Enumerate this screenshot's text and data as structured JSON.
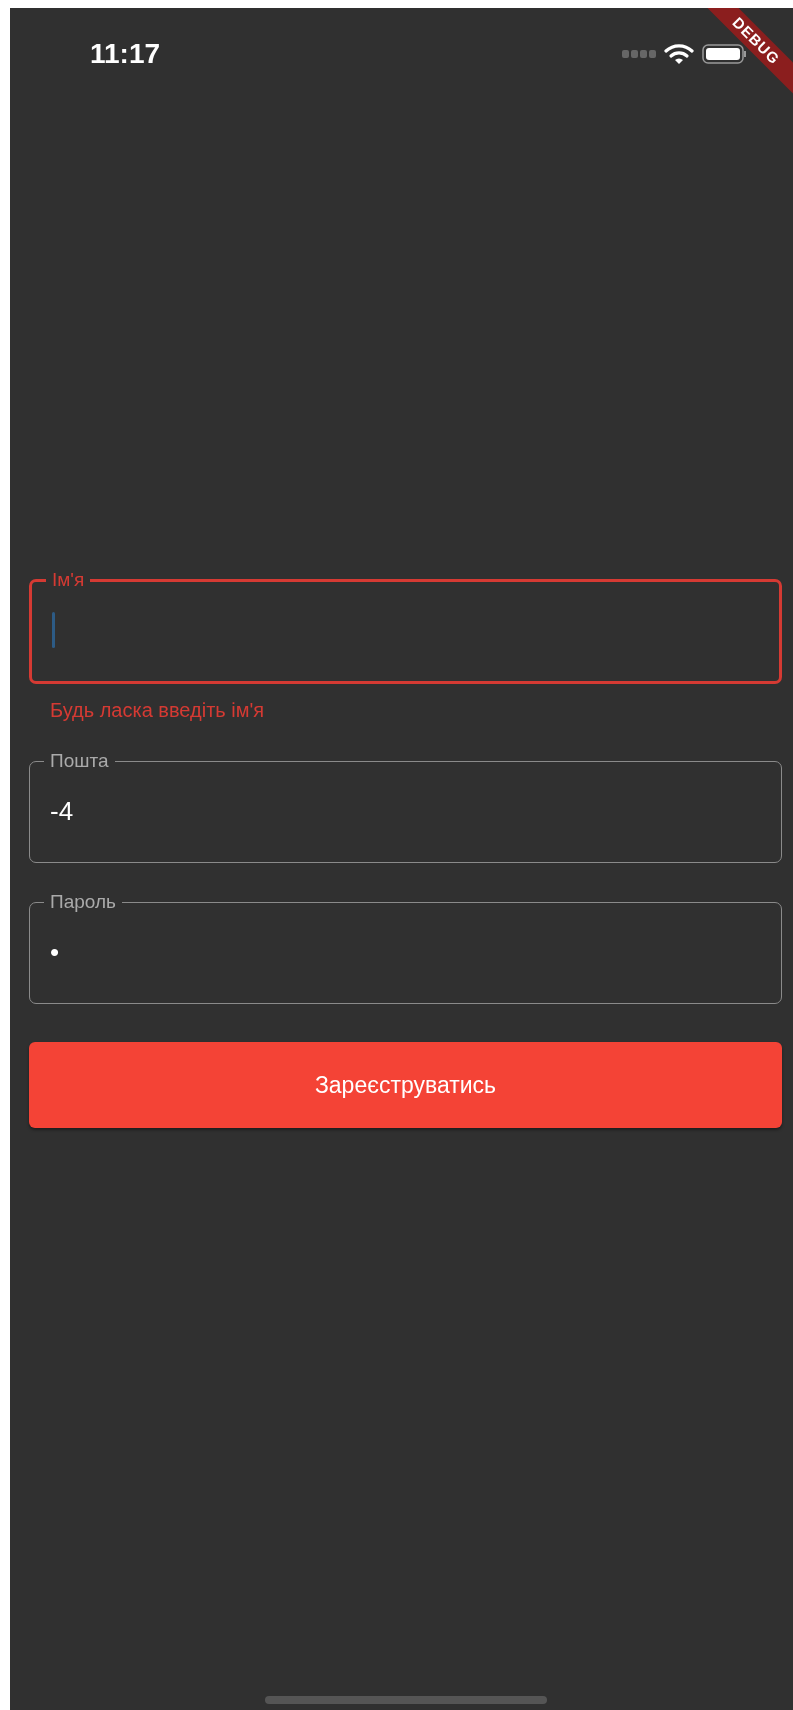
{
  "status_bar": {
    "time": "11:17"
  },
  "debug_banner": "DEBUG",
  "fields": [
    {
      "label": "Ім'я",
      "focused": true,
      "error_text": "Будь ласка введіть ім'я"
    },
    {
      "label": "Пошта",
      "value": "-4",
      "focused": false
    },
    {
      "label": "Пароль",
      "value": "•",
      "focused": false
    }
  ],
  "submit_button": "Зареєструватись"
}
